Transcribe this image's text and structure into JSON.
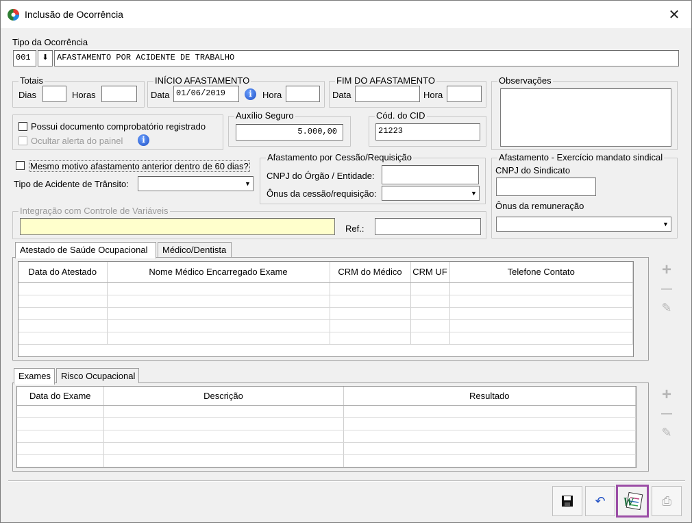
{
  "window": {
    "title": "Inclusão de Ocorrência",
    "close_label": "✕"
  },
  "tipo": {
    "label": "Tipo da Ocorrência",
    "code": "001",
    "description": "AFASTAMENTO POR ACIDENTE DE TRABALHO"
  },
  "totais": {
    "legend": "Totais",
    "dias_label": "Dias",
    "horas_label": "Horas",
    "dias_value": "",
    "horas_value": ""
  },
  "inicio": {
    "legend": "INÍCIO AFASTAMENTO",
    "data_label": "Data",
    "data_value": "01/06/2019",
    "hora_label": "Hora",
    "hora_value": "",
    "info_glyph": "i"
  },
  "fim": {
    "legend": "FIM DO AFASTAMENTO",
    "data_label": "Data",
    "data_value": "",
    "hora_label": "Hora",
    "hora_value": ""
  },
  "observacoes": {
    "legend": "Observações",
    "value": ""
  },
  "documento": {
    "possui_label": "Possui documento comprobatório registrado",
    "ocultar_label": "Ocultar alerta do painel",
    "info_glyph": "i"
  },
  "auxilio": {
    "legend": "Auxílio Seguro",
    "value": "5.000,00"
  },
  "cid": {
    "legend": "Cód. do CID",
    "value": "21223"
  },
  "mesmo_motivo": {
    "label": "Mesmo motivo afastamento anterior dentro de 60 dias?"
  },
  "transito": {
    "label": "Tipo de Acidente de Trânsito:",
    "value": ""
  },
  "cessao": {
    "legend": "Afastamento por Cessão/Requisição",
    "cnpj_label": "CNPJ do Órgão / Entidade:",
    "cnpj_value": "",
    "onus_label": "Ônus da cessão/requisição:",
    "onus_value": ""
  },
  "sindical": {
    "legend": "Afastamento - Exercício mandato sindical",
    "cnpj_label": "CNPJ do Sindicato",
    "cnpj_value": "",
    "onus_label": "Ônus da remuneração",
    "onus_value": ""
  },
  "integracao": {
    "legend": "Integração com Controle de Variáveis",
    "value": "",
    "ref_label": "Ref.:",
    "ref_value": ""
  },
  "atestado_tabs": [
    {
      "label": "Atestado de Saúde Ocupacional"
    },
    {
      "label": "Médico/Dentista"
    }
  ],
  "atestado_columns": [
    "Data do Atestado",
    "Nome Médico Encarregado Exame",
    "CRM do Médico",
    "CRM UF",
    "Telefone Contato"
  ],
  "exames_tabs": [
    {
      "label": "Exames"
    },
    {
      "label": "Risco Ocupacional"
    }
  ],
  "exames_columns": [
    "Data do Exame",
    "Descrição",
    "Resultado"
  ],
  "side_buttons": {
    "add": "+",
    "remove": "—",
    "edit": "✎"
  },
  "toolbar": {
    "save_glyph": "💾",
    "undo_glyph": "↶",
    "word_glyph": "W",
    "print_glyph": "⎙",
    "highlight_color": "#9b4ea6"
  },
  "colors": {
    "integration_bg": "#ffffcc",
    "info_blue": "#1f4fc4"
  }
}
